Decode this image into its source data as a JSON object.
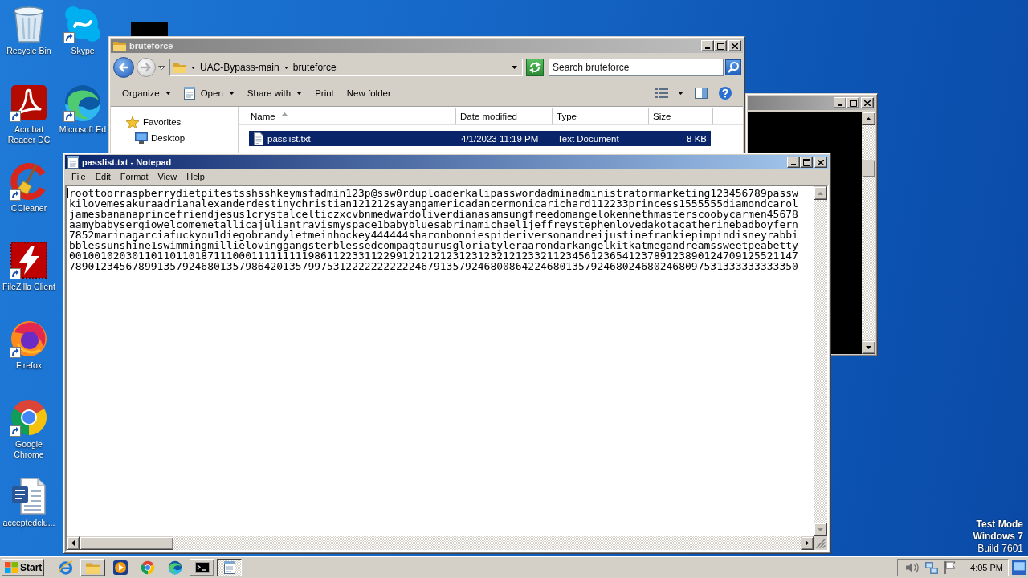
{
  "desktop": {
    "icons": [
      {
        "label": "Recycle Bin",
        "kind": "recycle-bin",
        "shortcut": false
      },
      {
        "label": "Acrobat Reader DC",
        "kind": "acrobat",
        "shortcut": true
      },
      {
        "label": "CCleaner",
        "kind": "ccleaner",
        "shortcut": true
      },
      {
        "label": "FileZilla Client",
        "kind": "filezilla",
        "shortcut": true
      },
      {
        "label": "Firefox",
        "kind": "firefox",
        "shortcut": true
      },
      {
        "label": "Google Chrome",
        "kind": "chrome",
        "shortcut": true
      },
      {
        "label": "acceptedclu...",
        "kind": "word-doc",
        "shortcut": false
      },
      {
        "label": "Skype",
        "kind": "skype",
        "shortcut": true
      },
      {
        "label": "Microsoft Ed",
        "kind": "edge",
        "shortcut": true
      }
    ],
    "edition": {
      "mode": "Test Mode",
      "os": "Windows 7",
      "build": "Build 7601"
    }
  },
  "explorer": {
    "title": "bruteforce",
    "active": false,
    "breadcrumbs": [
      "UAC-Bypass-main",
      "bruteforce"
    ],
    "search": {
      "placeholder": "Search bruteforce"
    },
    "toolbar": [
      {
        "label": "Organize",
        "kind": "menu"
      },
      {
        "label": "Open",
        "kind": "app-menu"
      },
      {
        "label": "Share with",
        "kind": "menu"
      },
      {
        "label": "Print",
        "kind": "command"
      },
      {
        "label": "New folder",
        "kind": "command"
      }
    ],
    "nav": [
      {
        "label": "Favorites",
        "children": [
          {
            "label": "Desktop"
          }
        ]
      }
    ],
    "columns": [
      {
        "label": "Name",
        "sorted": true
      },
      {
        "label": "Date modified",
        "sorted": false
      },
      {
        "label": "Type",
        "sorted": false
      },
      {
        "label": "Size",
        "sorted": false
      }
    ],
    "rows": [
      {
        "name": "passlist.txt",
        "date_modified": "4/1/2023 11:19 PM",
        "type": "Text Document",
        "size": "8 KB",
        "selected": true
      }
    ]
  },
  "console": {
    "active": false
  },
  "notepad": {
    "title": "passlist.txt - Notepad",
    "active": true,
    "menu": [
      "File",
      "Edit",
      "Format",
      "View",
      "Help"
    ],
    "lines": [
      "roottoorraspberrydietpitestsshsshkeymsfadmin123p@ssw0rduploaderkalipasswordadminadministratormarketing123456789passw",
      "kilovemesakuraadrianalexanderdestinychristian121212sayangamericadancermonicarichard112233princess1555555diamondcarol",
      "jamesbananaprincefriendjesus1crystalcelticzxcvbnmedwardoliverdianasamsungfreedomangelokennethmasterscoobycarmen45678",
      "aamybabysergiowelcomemetallicajuliantravismyspace1babybluesabrinamichael1jeffreystephenlovedakotacatherinebadboyfern",
      "7852marinagarciafuckyou1diegobrandyletmeinhockey444444sharonbonniespideriversonandreijustinefrankiepimpindisneyrabbi",
      "bblessunshine1swimmingmillielovinggangsterblessedcompaqtaurusgloriatyleraarondarkangelkitkatmegandreamssweetpeabetty",
      "00100102030110110110187111000111111111986112233112299121212123123123212123321123456123654123789123890124709125521147",
      "78901234567899135792468013579864201357997531222222222224679135792468008642246801357924680246802468097531333333333350"
    ]
  },
  "taskbar": {
    "start": "Start",
    "items": [
      {
        "kind": "ie",
        "running": false,
        "selected": false
      },
      {
        "kind": "explorer",
        "running": true,
        "selected": false
      },
      {
        "kind": "media",
        "running": false,
        "selected": false
      },
      {
        "kind": "chrome",
        "running": false,
        "selected": false
      },
      {
        "kind": "edge",
        "running": false,
        "selected": false
      },
      {
        "kind": "console",
        "running": true,
        "selected": false
      },
      {
        "kind": "notepad",
        "running": true,
        "selected": true
      }
    ],
    "clock": "4:05 PM"
  }
}
